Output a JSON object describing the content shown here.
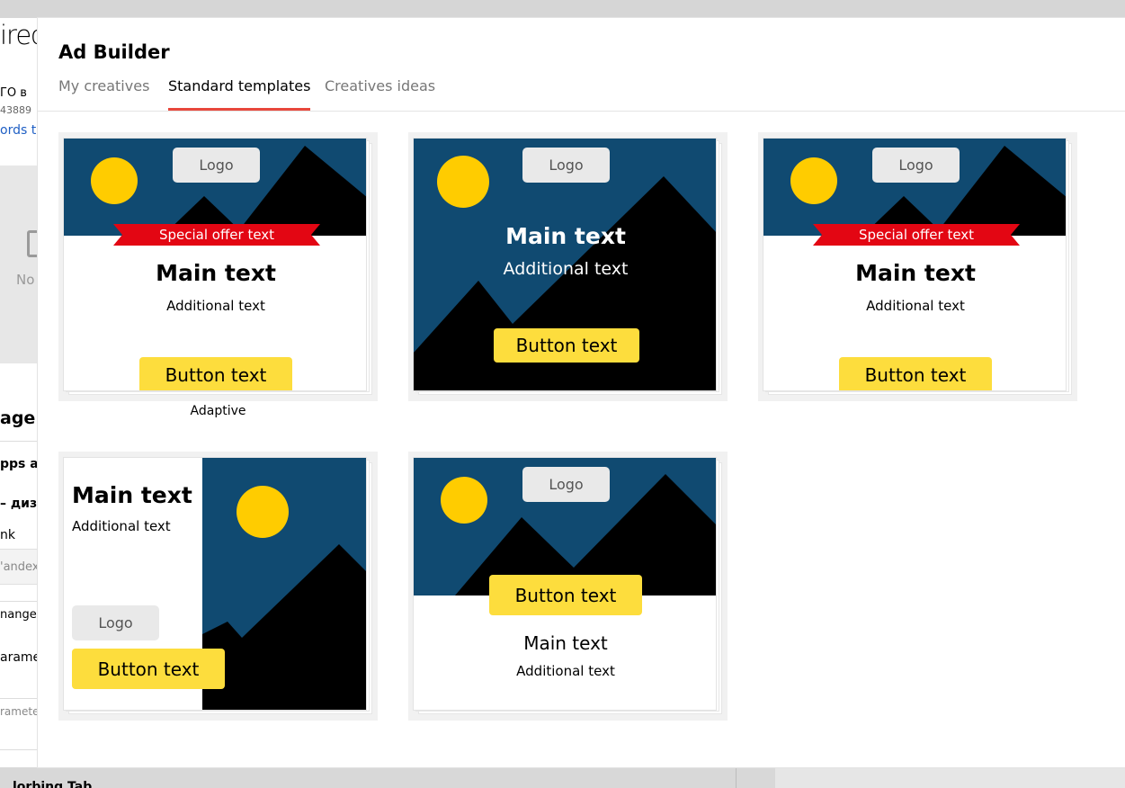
{
  "background": {
    "logo_fragment": "irect",
    "account_fragment": "ГО в",
    "number_fragment": "43889",
    "link_fragment": "ords t",
    "preview_fragment": "No",
    "section_fragment": "age",
    "apps_fragment": "pps ar",
    "design_fragment": "– диза",
    "link_label_fragment": "nk",
    "input_fragment": "'andex",
    "change_fragment": "nange",
    "params_fragment": "arame",
    "params2_fragment": "rameter",
    "bottom_fragment": "lorbing Tab"
  },
  "modal": {
    "title": "Ad Builder",
    "tabs": [
      {
        "label": "My creatives",
        "active": false
      },
      {
        "label": "Standard templates",
        "active": true
      },
      {
        "label": "Creatives ideas",
        "active": false
      }
    ]
  },
  "templates": [
    {
      "logo": "Logo",
      "offer": "Special offer text",
      "main_text": "Main text",
      "additional_text": "Additional text",
      "button": "Button text",
      "label": "Adaptive"
    },
    {
      "logo": "Logo",
      "main_text": "Main text",
      "additional_text": "Additional text",
      "button": "Button text"
    },
    {
      "logo": "Logo",
      "offer": "Special offer text",
      "main_text": "Main text",
      "additional_text": "Additional text",
      "button": "Button text"
    },
    {
      "logo": "Logo",
      "main_text": "Main text",
      "additional_text": "Additional text",
      "button": "Button text"
    },
    {
      "logo": "Logo",
      "main_text": "Main text",
      "additional_text": "Additional text",
      "button": "Button text"
    }
  ],
  "colors": {
    "sky": "#104a71",
    "sun": "#ffcc00",
    "mountain": "#000000",
    "ribbon": "#e30613",
    "button": "#fddd3d",
    "active_tab_underline": "#e8473b"
  }
}
